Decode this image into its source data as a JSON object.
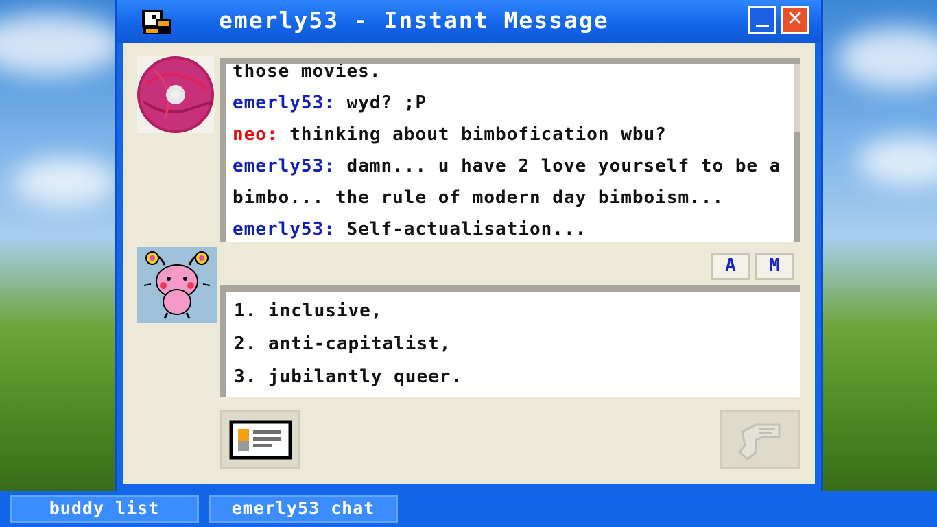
{
  "window": {
    "title": "emerly53 - Instant Message"
  },
  "chat": {
    "partial_top": "those movies.",
    "messages": [
      {
        "sender": "emerly53:",
        "text": " wyd? ;P"
      },
      {
        "sender": "neo:",
        "text": " thinking about bimbofication wbu?"
      },
      {
        "sender": "emerly53:",
        "text": " damn... u have 2 love yourself to be a bimbo... the rule of modern day bimboism..."
      },
      {
        "sender": "emerly53:",
        "text": "  Self-actualisation..."
      }
    ]
  },
  "format": {
    "font_label": "A",
    "style_label": "M"
  },
  "compose": {
    "text": "1. inclusive,\n2. anti-capitalist,\n3. jubilantly queer."
  },
  "taskbar": {
    "items": [
      {
        "label": "buddy list"
      },
      {
        "label": "emerly53 chat"
      }
    ]
  },
  "icons": {
    "title": "duck-icon",
    "profile": "profile-card-icon",
    "send": "send-icon",
    "minimize": "minimize-icon",
    "close": "close-icon"
  },
  "colors": {
    "window_blue": "#1466e8",
    "client_bg": "#ece9d8",
    "sender_self": "#1020b8",
    "sender_buddy": "#e01010"
  }
}
